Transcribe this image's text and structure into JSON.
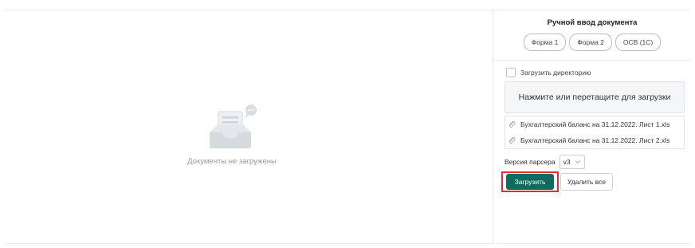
{
  "empty_state": {
    "text": "Документы не загружены",
    "icon": "empty-inbox-icon"
  },
  "manual_entry": {
    "title": "Ручной ввод документа",
    "forms": [
      "Форма 1",
      "Форма 2",
      "ОСВ (1С)"
    ]
  },
  "upload": {
    "directory_checkbox_label": "Загрузить директорию",
    "directory_checked": false,
    "dropzone_text": "Нажмите или перетащите для загрузки",
    "files": [
      "Бухгалтерский баланс на 31.12.2022. Лист 1.xls",
      "Бухгалтерский баланс на 31.12.2022. Лист 2.xls"
    ],
    "file_icon": "paperclip-icon"
  },
  "parser": {
    "label": "Версия парсера",
    "selected": "v3"
  },
  "actions": {
    "upload_label": "Загрузить",
    "delete_all_label": "Удалить все"
  },
  "colors": {
    "primary": "#0f6b5e",
    "highlight": "#e02d2d"
  }
}
